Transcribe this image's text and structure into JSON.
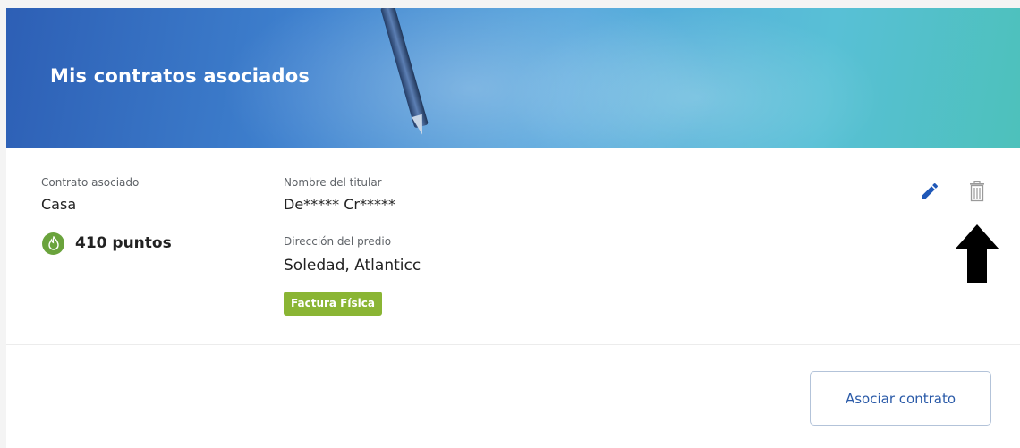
{
  "banner": {
    "title": "Mis contratos asociados"
  },
  "contract": {
    "contract_label": "Contrato asociado",
    "contract_value": "Casa",
    "points_text": "410 puntos",
    "holder_label": "Nombre del titular",
    "holder_value": "De***** Cr*****",
    "address_label": "Dirección del predio",
    "address_value": "Soledad, Atlanticc",
    "badge": "Factura Física"
  },
  "actions": {
    "edit_icon": "pencil-icon",
    "delete_icon": "trash-icon",
    "arrow_icon": "up-arrow-icon"
  },
  "footer": {
    "associate_button": "Asociar contrato"
  },
  "colors": {
    "accent": "#2a5aa8",
    "badge": "#8ab534",
    "points_icon": "#6aa33c",
    "banner_start": "#2d5fb5",
    "banner_end": "#4dc1bb"
  }
}
